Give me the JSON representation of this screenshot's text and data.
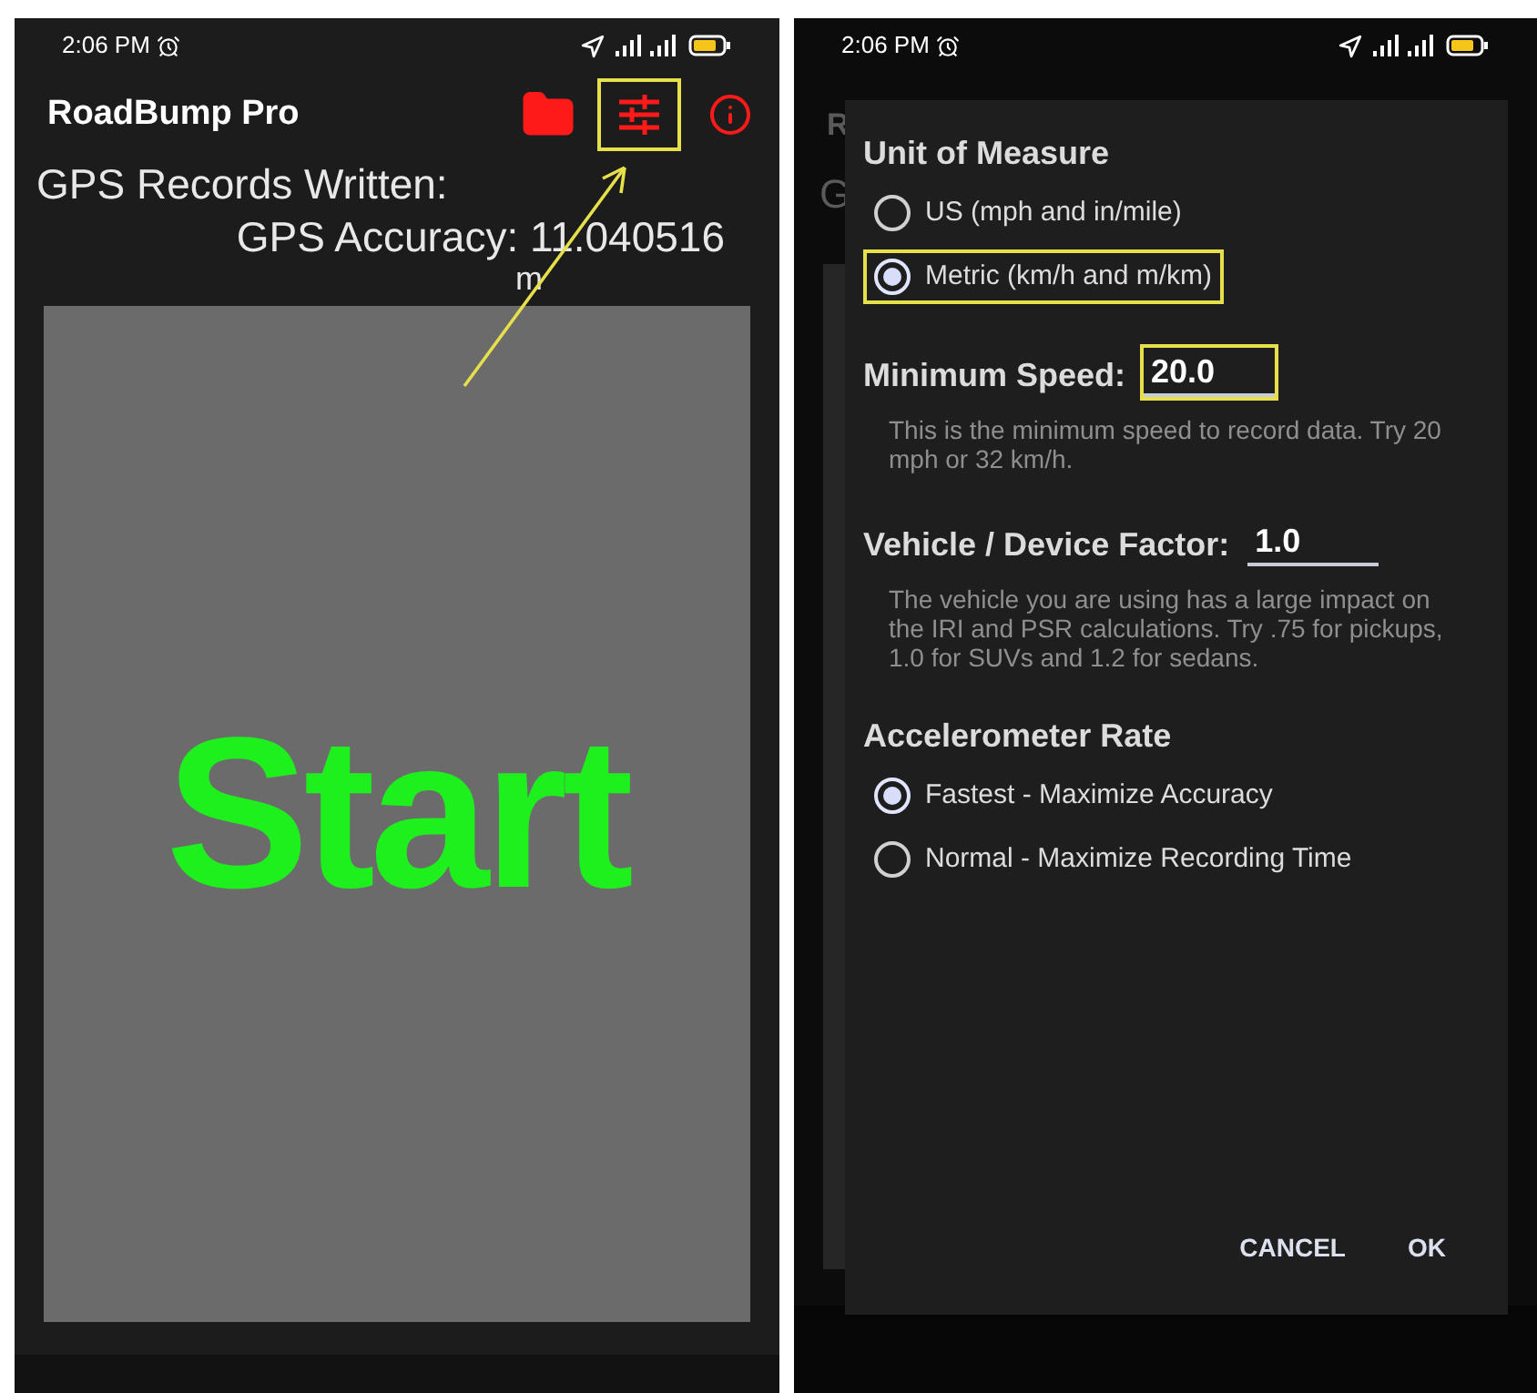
{
  "left_screen": {
    "status_bar": {
      "time": "2:06 PM"
    },
    "app_bar": {
      "title": "RoadBump Pro",
      "actions": [
        {
          "kind": "folder",
          "highlighted": false
        },
        {
          "kind": "settings",
          "highlighted": true
        },
        {
          "kind": "info",
          "highlighted": false
        }
      ]
    },
    "gps_records_label": "GPS Records Written:",
    "gps_accuracy": {
      "label": "GPS Accuracy: 11.040516",
      "unit": "m"
    },
    "start_button": "Start"
  },
  "right_screen": {
    "status_bar": {
      "time": "2:06 PM"
    },
    "background_fragments": [
      "R",
      "G"
    ],
    "dialog": {
      "sections": [
        {
          "kind": "radio_group",
          "title": "Unit of Measure",
          "options": [
            {
              "label": "US (mph and in/mile)",
              "selected": false,
              "highlighted": false
            },
            {
              "label": "Metric (km/h and m/km)",
              "selected": true,
              "highlighted": true
            }
          ]
        },
        {
          "kind": "field",
          "label": "Minimum Speed:",
          "value": "20.0",
          "highlighted": true,
          "help": "This is the minimum speed to record data. Try 20 mph or 32 km/h."
        },
        {
          "kind": "field",
          "label": "Vehicle / Device Factor:",
          "value": "1.0",
          "highlighted": false,
          "help": "The vehicle you are using has a large impact on the IRI and PSR calculations. Try .75 for pickups, 1.0 for SUVs and 1.2 for sedans."
        },
        {
          "kind": "radio_group",
          "title": "Accelerometer Rate",
          "options": [
            {
              "label": "Fastest - Maximize Accuracy",
              "selected": true,
              "highlighted": false
            },
            {
              "label": "Normal - Maximize Recording Time",
              "selected": false,
              "highlighted": false
            }
          ]
        }
      ],
      "buttons": [
        "CANCEL",
        "OK"
      ]
    }
  }
}
